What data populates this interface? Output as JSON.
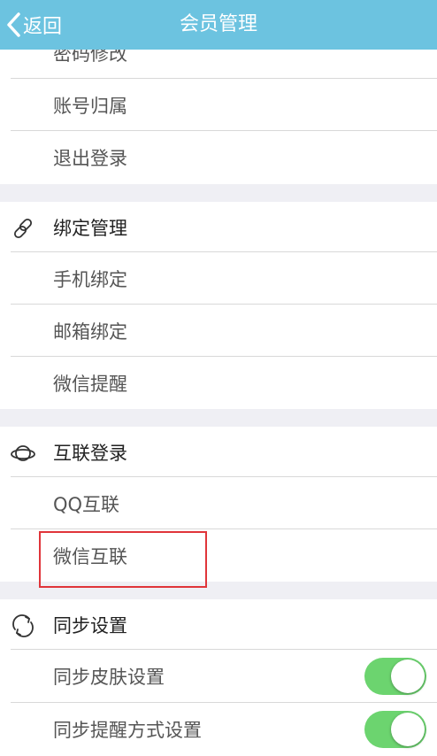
{
  "navbar": {
    "back_label": "返回",
    "title": "会员管理"
  },
  "account_section": {
    "items": [
      {
        "label": "密码修改"
      },
      {
        "label": "账号归属"
      },
      {
        "label": "退出登录"
      }
    ]
  },
  "binding_section": {
    "header": "绑定管理",
    "icon": "link-icon",
    "items": [
      {
        "label": "手机绑定"
      },
      {
        "label": "邮箱绑定"
      },
      {
        "label": "微信提醒"
      }
    ]
  },
  "connect_section": {
    "header": "互联登录",
    "icon": "planet-icon",
    "items": [
      {
        "label": "QQ互联"
      },
      {
        "label": "微信互联",
        "highlighted": true
      }
    ]
  },
  "sync_section": {
    "header": "同步设置",
    "icon": "sync-icon",
    "items": [
      {
        "label": "同步皮肤设置",
        "toggle_on": true
      },
      {
        "label": "同步提醒方式设置",
        "toggle_on": true
      }
    ]
  },
  "colors": {
    "navbar": "#6cc3e0",
    "toggle_on": "#6cd46f",
    "highlight": "#e0353a",
    "background": "#efeff4"
  }
}
